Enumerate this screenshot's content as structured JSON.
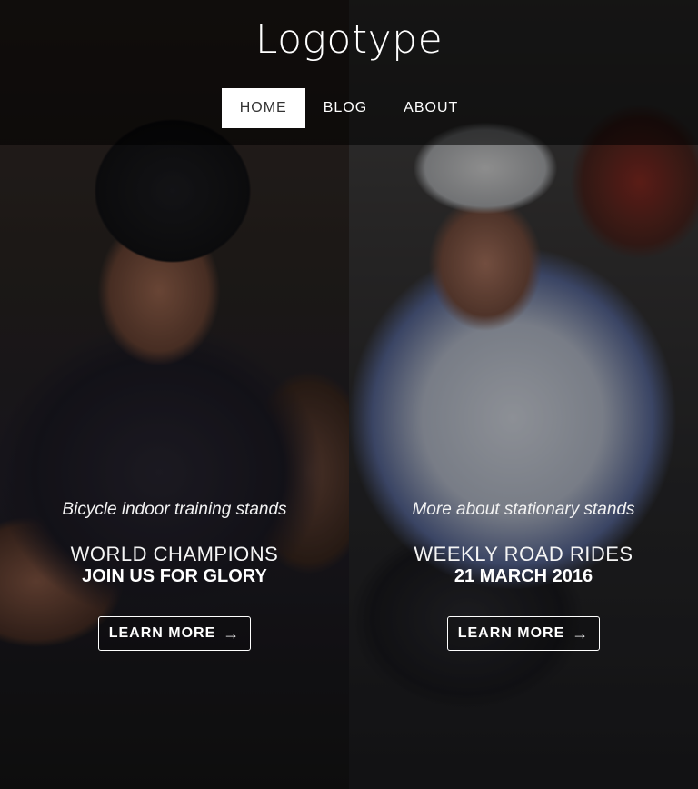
{
  "brand": {
    "logo_text": "Logotype"
  },
  "nav": {
    "items": [
      {
        "label": "HOME"
      },
      {
        "label": "BLOG"
      },
      {
        "label": "ABOUT"
      }
    ]
  },
  "slides": [
    {
      "subtitle": "Bicycle indoor training stands",
      "title_line1": "WORLD CHAMPIONS",
      "title_line2": "JOIN US FOR GLORY",
      "button_label": "LEARN MORE",
      "button_icon": "arrow-right-icon"
    },
    {
      "subtitle": "More about stationary stands",
      "title_line1": "WEEKLY ROAD RIDES",
      "title_line2": "21 MARCH 2016",
      "button_label": "LEARN MORE",
      "button_icon": "arrow-right-icon"
    }
  ],
  "colors": {
    "nav_active_bg": "#ffffff",
    "nav_active_text": "#333333",
    "text": "#ffffff"
  }
}
